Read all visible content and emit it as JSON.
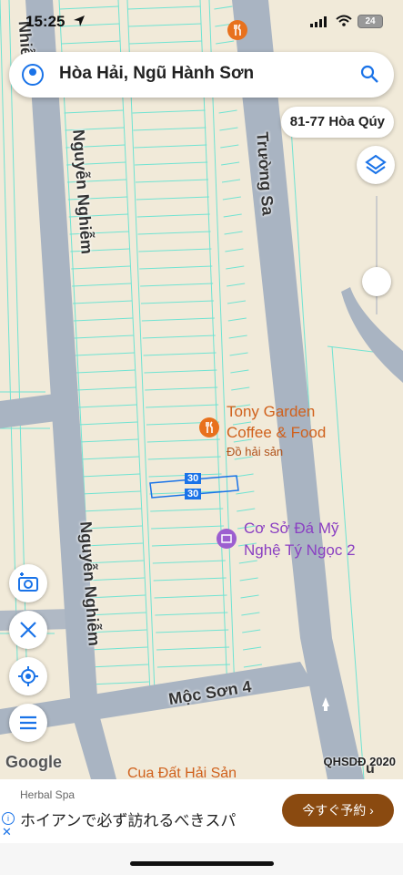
{
  "status_bar": {
    "time": "15:25",
    "battery": "24"
  },
  "search": {
    "query": "Hòa Hải, Ngũ Hành Sơn"
  },
  "address_pill": "81-77 Hòa Qúy",
  "streets": {
    "nguyen_nghiem_top": "Nguyễn Nghiễm",
    "nguyen_nghiem_bottom": "Nguyễn Nghiễm",
    "truong_sa": "Trường Sa",
    "moc_son_4": "Mộc Sơn 4",
    "left_edge": "Nhiễ",
    "right_edge": "u"
  },
  "lot_labels": [
    "30",
    "30"
  ],
  "pois": {
    "tony_garden": {
      "name_line1": "Tony Garden",
      "name_line2": "Coffee & Food",
      "category": "Đồ hải sản"
    },
    "co_so_da": {
      "name_line1": "Cơ Sở Đá Mỹ",
      "name_line2": "Nghệ Tý Ngọc 2"
    },
    "cua_dat": {
      "name": "Cua Đất Hải Sản"
    }
  },
  "attribution": {
    "google": "Google",
    "map_source": "QHSDĐ 2020"
  },
  "ad": {
    "subtitle": "Herbal Spa",
    "title": "ホイアンで必ず訪れるべきスパ",
    "cta": "今すぐ予約"
  },
  "colors": {
    "road": "#a9b4c2",
    "parcel_line": "#6fe3d2",
    "land": "#f1ead9",
    "accent": "#1a73e8",
    "cta_bg": "#8a4a10"
  }
}
